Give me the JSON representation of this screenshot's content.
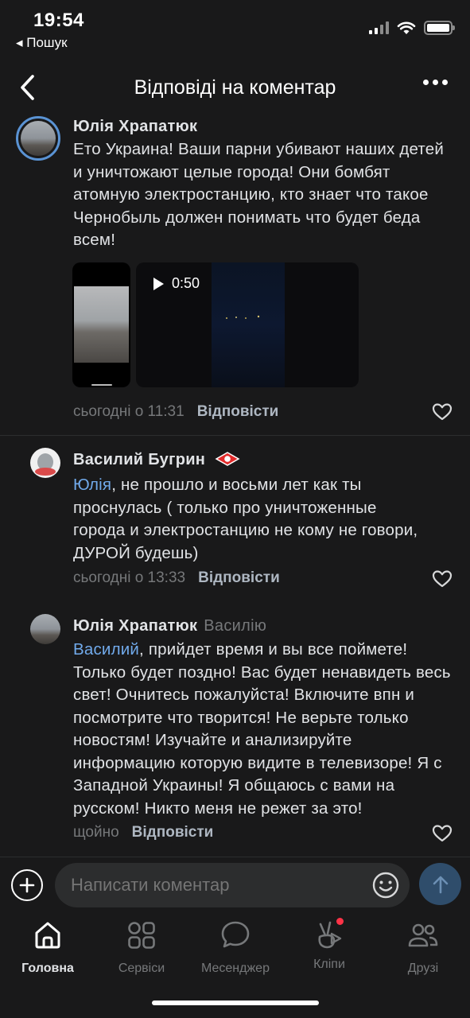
{
  "status_bar": {
    "time": "19:54",
    "back_label": "◂ Пошук"
  },
  "header": {
    "title": "Відповіді на коментар"
  },
  "comments": [
    {
      "author": "Юлія Храпатюк",
      "text": "Ето Украина! Ваши парни убивают наших детей и уничтожают целые города! Они бомбят атомную электростанцию, кто знает что такое Чернобыль должен понимать что будет беда всем!",
      "video_duration": "0:50",
      "time": "сьогодні о 11:31",
      "reply_label": "Відповісти"
    },
    {
      "author": "Василий Бугрин",
      "mention": "Юлія",
      "text": ", не прошло и восьми лет как ты проснулась ( только про уничтоженные города и электростанцию не кому не говори, ДУРОЙ будешь)",
      "time": "сьогодні о 13:33",
      "reply_label": "Відповісти"
    },
    {
      "author": "Юлія Храпатюк",
      "reply_to": "Василію",
      "mention": "Василий",
      "text": ", прийдет время и вы все поймете! Только будет поздно! Вас будет ненавидеть весь свет! Очнитесь пожалуйста! Включите впн и посмотрите что творится! Не верьте только новостям! Изучайте и анализируйте информацию которую видите в телевизоре! Я с Западной Украины! Я общаюсь с вами на русском! Никто меня не режет за это!",
      "time": "щойно",
      "reply_label": "Відповісти"
    }
  ],
  "composer": {
    "placeholder": "Написати коментар"
  },
  "tabs": [
    {
      "label": "Головна",
      "icon": "home-icon",
      "active": true
    },
    {
      "label": "Сервіси",
      "icon": "services-grid-icon"
    },
    {
      "label": "Месенджер",
      "icon": "chat-bubble-icon"
    },
    {
      "label": "Кліпи",
      "icon": "clips-icon",
      "badge": true
    },
    {
      "label": "Друзі",
      "icon": "friends-icon"
    }
  ],
  "colors": {
    "background": "#19191a",
    "text": "#e1e3e6",
    "secondary": "#76787a",
    "link": "#71aaeb",
    "badge": "#ff3347"
  }
}
